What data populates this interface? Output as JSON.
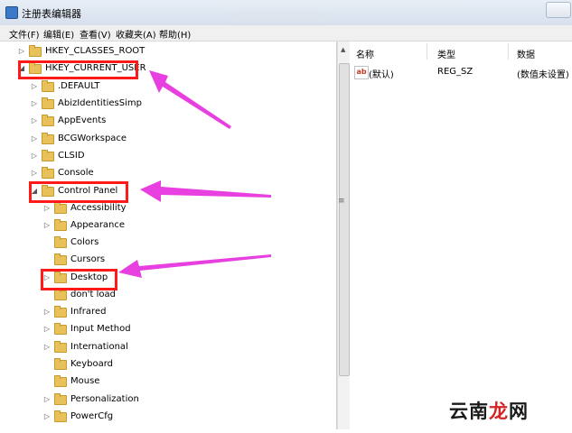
{
  "window": {
    "title": "注册表编辑器",
    "menu": [
      "文件(F)",
      "编辑(E)",
      "查看(V)",
      "收藏夹(A)",
      "帮助(H)"
    ]
  },
  "tree": {
    "nodes": [
      {
        "label": "HKEY_CLASSES_ROOT",
        "expander": "▷"
      },
      {
        "label": "HKEY_CURRENT_USER",
        "expander": "◢"
      },
      {
        "label": ".DEFAULT",
        "expander": "▷"
      },
      {
        "label": "AbizIdentitiesSimp",
        "expander": "▷"
      },
      {
        "label": "AppEvents",
        "expander": "▷"
      },
      {
        "label": "BCGWorkspace",
        "expander": "▷"
      },
      {
        "label": "CLSID",
        "expander": "▷"
      },
      {
        "label": "Console",
        "expander": "▷"
      },
      {
        "label": "Control Panel",
        "expander": "◢"
      },
      {
        "label": "Accessibility",
        "expander": "▷"
      },
      {
        "label": "Appearance",
        "expander": "▷"
      },
      {
        "label": "Colors",
        "expander": ""
      },
      {
        "label": "Cursors",
        "expander": ""
      },
      {
        "label": "Desktop",
        "expander": "▷"
      },
      {
        "label": "don't load",
        "expander": ""
      },
      {
        "label": "Infrared",
        "expander": "▷"
      },
      {
        "label": "Input Method",
        "expander": "▷"
      },
      {
        "label": "International",
        "expander": "▷"
      },
      {
        "label": "Keyboard",
        "expander": ""
      },
      {
        "label": "Mouse",
        "expander": ""
      },
      {
        "label": "Personalization",
        "expander": "▷"
      },
      {
        "label": "PowerCfg",
        "expander": "▷"
      }
    ]
  },
  "values_pane": {
    "columns": [
      "名称",
      "类型",
      "数据"
    ],
    "rows": [
      {
        "name": "(默认)",
        "type": "REG_SZ",
        "data": "(数值未设置)",
        "icon": "ab-string-icon"
      }
    ]
  },
  "annotations": {
    "highlight_color": "#ff1a1a",
    "arrow_color": "#e83fe0"
  },
  "watermark": {
    "text_prefix": "云南",
    "text_accent": "龙",
    "text_suffix": "网"
  }
}
